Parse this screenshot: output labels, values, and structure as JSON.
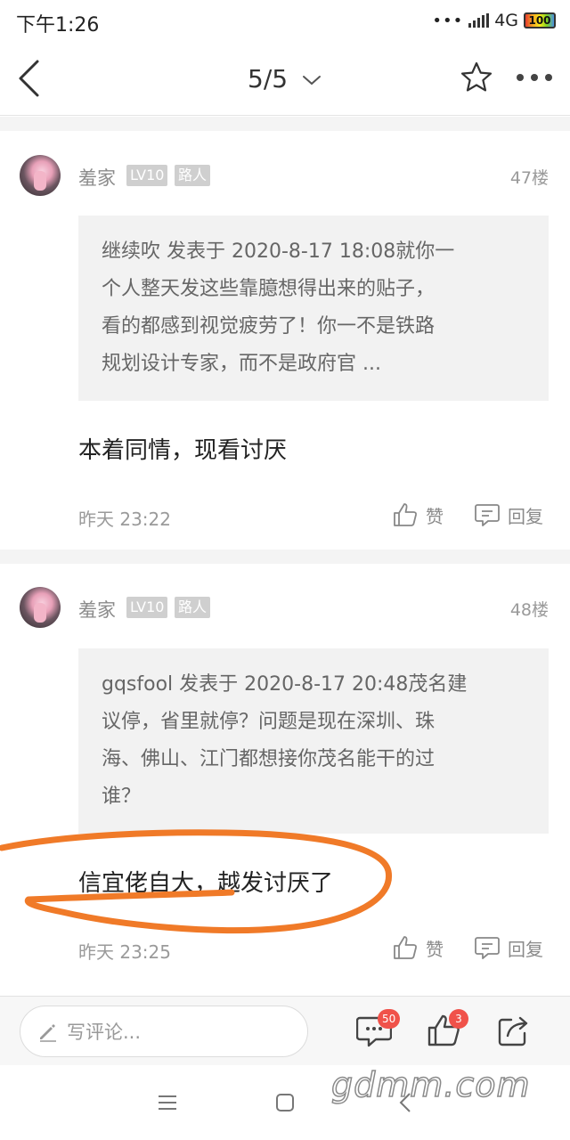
{
  "status_bar": {
    "time": "下午1:26",
    "network": "4G",
    "battery": "100"
  },
  "nav": {
    "page": "5/5"
  },
  "posts": [
    {
      "user": "羞家",
      "level": "LV10",
      "rank": "路人",
      "floor": "47楼",
      "quote_lines": [
        "继续吹 发表于 2020-8-17 18:08就你一",
        "个人整天发这些靠臆想得出来的贴子，",
        "看的都感到视觉疲劳了！你一不是铁路",
        "规划设计专家，而不是政府官 ..."
      ],
      "content": "本着同情，现看讨厌",
      "time": "昨天 23:22",
      "like_label": "赞",
      "reply_label": "回复"
    },
    {
      "user": "羞家",
      "level": "LV10",
      "rank": "路人",
      "floor": "48楼",
      "quote_lines": [
        "gqsfool 发表于 2020-8-17 20:48茂名建",
        "议停，省里就停？问题是现在深圳、珠",
        "海、佛山、江门都想接你茂名能干的过",
        "谁？"
      ],
      "content": "信宜佬自大，越发讨厌了",
      "time": "昨天 23:25",
      "like_label": "赞",
      "reply_label": "回复"
    }
  ],
  "bottom_bar": {
    "comment_placeholder": "写评论...",
    "comment_count": "50",
    "like_count": "3"
  },
  "watermark": "gdmm.com",
  "colors": {
    "annotation": "#f07a28",
    "badge_red": "#f0524a"
  }
}
